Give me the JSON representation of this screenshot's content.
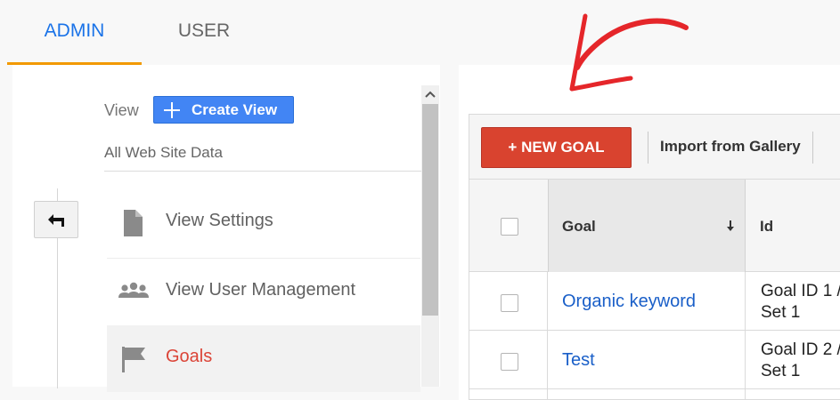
{
  "tabs": {
    "admin": "ADMIN",
    "user": "USER"
  },
  "sidebar": {
    "view_label": "View",
    "create_view_label": "Create View",
    "selected_view": "All Web Site Data",
    "items": [
      {
        "label": "View Settings",
        "icon": "document-icon"
      },
      {
        "label": "View User Management",
        "icon": "people-icon"
      },
      {
        "label": "Goals",
        "icon": "flag-icon",
        "active": true
      }
    ]
  },
  "goals": {
    "new_goal_label": "+ NEW GOAL",
    "import_label": "Import from Gallery",
    "columns": {
      "goal": "Goal",
      "id": "Id"
    },
    "rows": [
      {
        "name": "Organic keyword",
        "id_line1": "Goal ID 1 /",
        "id_line2": "Set 1"
      },
      {
        "name": "Test",
        "id_line1": "Goal ID 2 /",
        "id_line2": "Set 1"
      }
    ]
  },
  "colors": {
    "accent_blue": "#4285f4",
    "tab_blue": "#1a73e8",
    "tab_underline": "#f29900",
    "new_goal_red": "#d9432f",
    "active_red": "#db4437",
    "link_blue": "#1a5fc8",
    "annotation_red": "#e5262a"
  }
}
